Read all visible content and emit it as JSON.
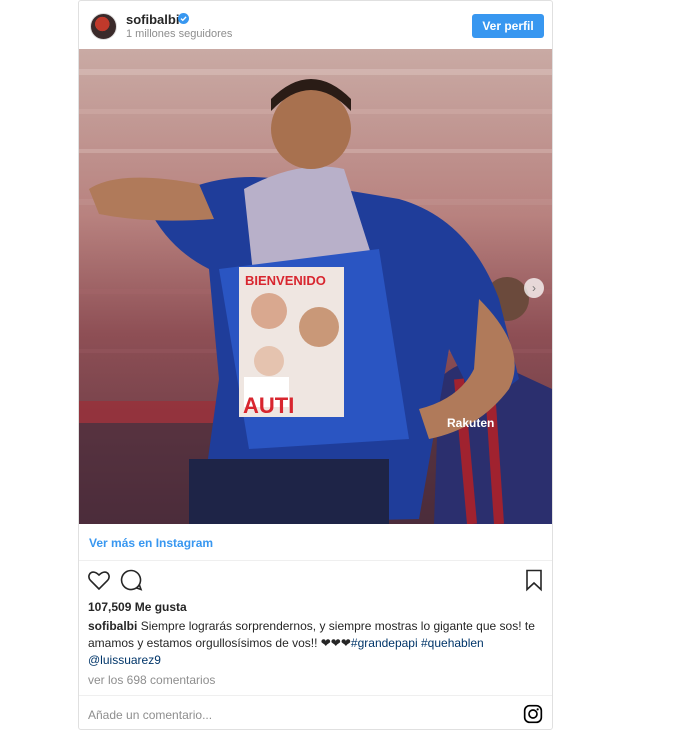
{
  "header": {
    "username": "sofibalbi",
    "followers": "1 millones seguidores",
    "view_profile": "Ver perfil"
  },
  "photo": {
    "shirt_text_top": "BIENVENIDO",
    "shirt_text_bottom": "AUTI",
    "sponsor": "Rakuten"
  },
  "actions": {
    "more_link": "Ver más en Instagram",
    "likes": "107,509 Me gusta"
  },
  "caption": {
    "user": "sofibalbi",
    "text": "Siempre lograrás sorprendernos, y siempre mostras lo gigante que sos! te amamos y estamos orgullosísimos de vos!! ❤❤❤",
    "tag1": "#grandepapi",
    "tag2": "#quehablen",
    "mention": "@luissuarez9"
  },
  "comments": {
    "view_all": "ver los 698 comentarios",
    "placeholder": "Añade un comentario..."
  },
  "colors": {
    "accent": "#3897f0",
    "text": "#262626",
    "muted": "#8e8e8e"
  },
  "icons": [
    "verified-icon",
    "heart-icon",
    "comment-icon",
    "bookmark-icon",
    "instagram-icon",
    "chevron-right-icon"
  ]
}
